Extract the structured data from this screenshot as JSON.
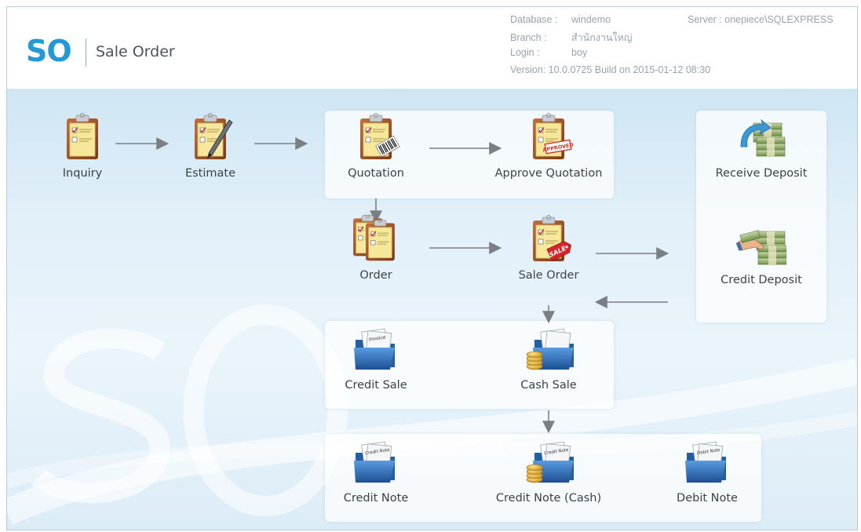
{
  "header": {
    "logo": "SO",
    "title": "Sale Order",
    "database_label": "Database :",
    "database_value": "windemo",
    "server_label": "Server :",
    "server_value": "onepiece\\SQLEXPRESS",
    "branch_label": "Branch :",
    "branch_value": "สำนักงานใหญ่",
    "login_label": "Login :",
    "login_value": "boy",
    "version_label": "Version:",
    "version_value": "10.0.0725",
    "build_label": "Build on",
    "build_value": "2015-01-12 08:30"
  },
  "flow": {
    "inquiry": "Inquiry",
    "estimate": "Estimate",
    "quotation": "Quotation",
    "approve_quotation": "Approve Quotation",
    "receive_deposit": "Receive Deposit",
    "order": "Order",
    "sale_order": "Sale Order",
    "credit_deposit": "Credit Deposit",
    "credit_sale": "Credit Sale",
    "cash_sale": "Cash Sale",
    "credit_note": "Credit Note",
    "credit_note_cash": "Credit Note (Cash)",
    "debit_note": "Debit Note"
  },
  "icon_text": {
    "approved_stamp": "APPROVED",
    "sale_tag": "SALE",
    "invoice_doc": "Invoice",
    "credit_note_doc": "Credit Note",
    "debit_note_doc": "Debit Note"
  },
  "colors": {
    "accent": "#2399d8",
    "clipboard": "#a0522d",
    "paper": "#f6e79a",
    "folder": "#2f6fb6",
    "money": "#6b8f4a",
    "coin": "#e2b13c",
    "arrow": "#7a7f85"
  }
}
